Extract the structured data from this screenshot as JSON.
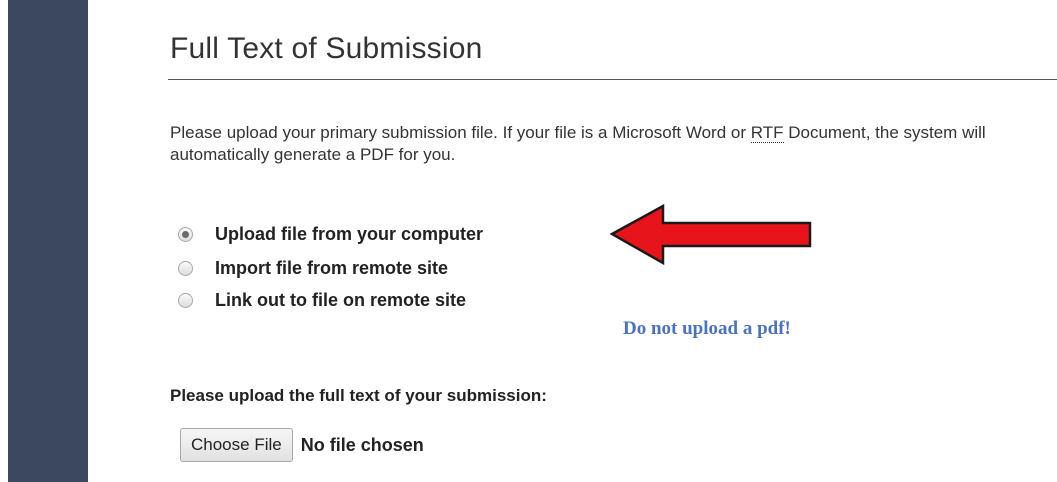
{
  "section": {
    "title": "Full Text of Submission"
  },
  "intro": {
    "text_before": "Please upload your primary submission file. If your file is a Microsoft Word or ",
    "abbr": "RTF",
    "text_after": " Document, the system will automatically generate a PDF for you."
  },
  "upload_options": [
    {
      "label": "Upload file from your computer",
      "selected": true
    },
    {
      "label": "Import file from remote site",
      "selected": false
    },
    {
      "label": "Link out to file on remote site",
      "selected": false
    }
  ],
  "annotation": {
    "arrow_color": "#e8141b",
    "note": "Do not upload a pdf!",
    "note_color": "#4a72c4"
  },
  "upload": {
    "label": "Please upload the full text of your submission:",
    "button_label": "Choose File",
    "status": "No file chosen"
  },
  "colors": {
    "sidebar": "#3b4860"
  }
}
